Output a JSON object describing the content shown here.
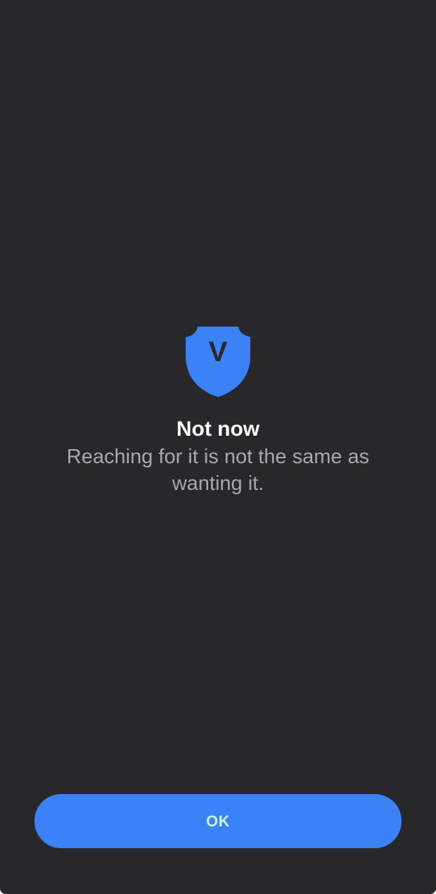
{
  "screen": {
    "background_color": "#28282a"
  },
  "logo": {
    "icon": "shield-icon",
    "letter": "V",
    "color": "#3b82f6",
    "letter_color": "#28282a"
  },
  "message": {
    "title": "Not now",
    "subtitle": "Reaching for it is not the same as wanting it."
  },
  "actions": {
    "ok_label": "OK",
    "ok_color": "#3b82f6",
    "ok_text_color": "#c6f6e6"
  }
}
